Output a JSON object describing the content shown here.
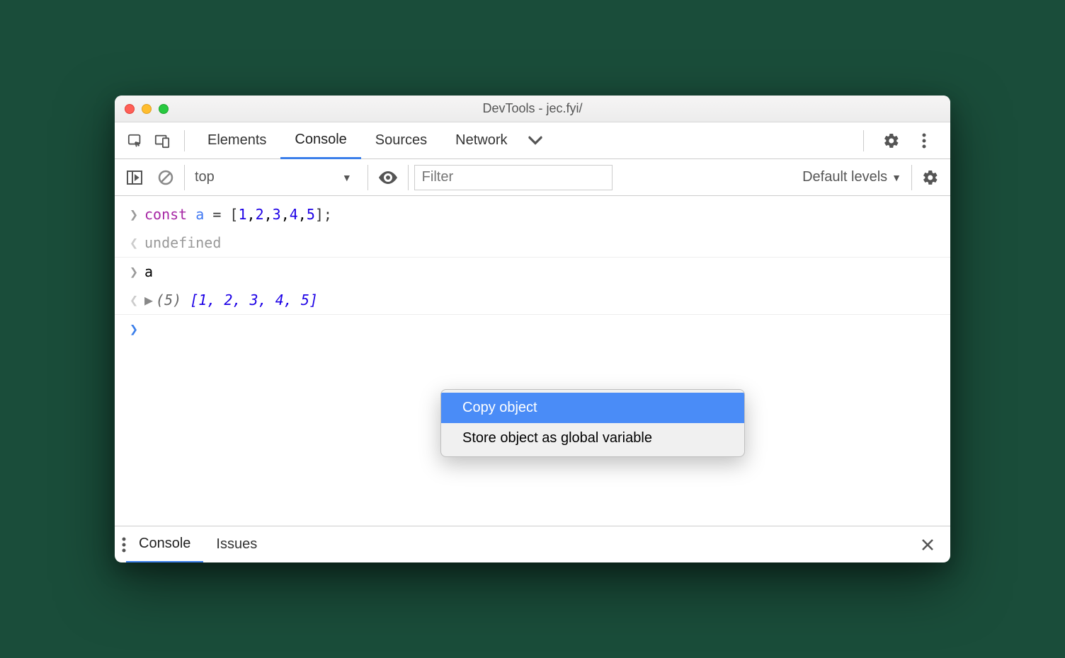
{
  "window": {
    "title": "DevTools - jec.fyi/"
  },
  "tabs": {
    "elements": "Elements",
    "console": "Console",
    "sources": "Sources",
    "network": "Network"
  },
  "toolbar": {
    "context": "top",
    "filter_placeholder": "Filter",
    "levels": "Default levels"
  },
  "console": {
    "line1_const": "const",
    "line1_ident": " a ",
    "line1_eq": "= [",
    "line1_n1": "1",
    "line1_c": ",",
    "line1_n2": "2",
    "line1_n3": "3",
    "line1_n4": "4",
    "line1_n5": "5",
    "line1_close": "];",
    "line2": "undefined",
    "line3": "a",
    "line4_len": "(5)",
    "line4_open": " [",
    "line4_v1": "1",
    "line4_v2": "2",
    "line4_v3": "3",
    "line4_v4": "4",
    "line4_v5": "5",
    "line4_close": "]",
    "line4_sep": ", "
  },
  "context_menu": {
    "copy": "Copy object",
    "store": "Store object as global variable"
  },
  "drawer": {
    "console": "Console",
    "issues": "Issues"
  }
}
